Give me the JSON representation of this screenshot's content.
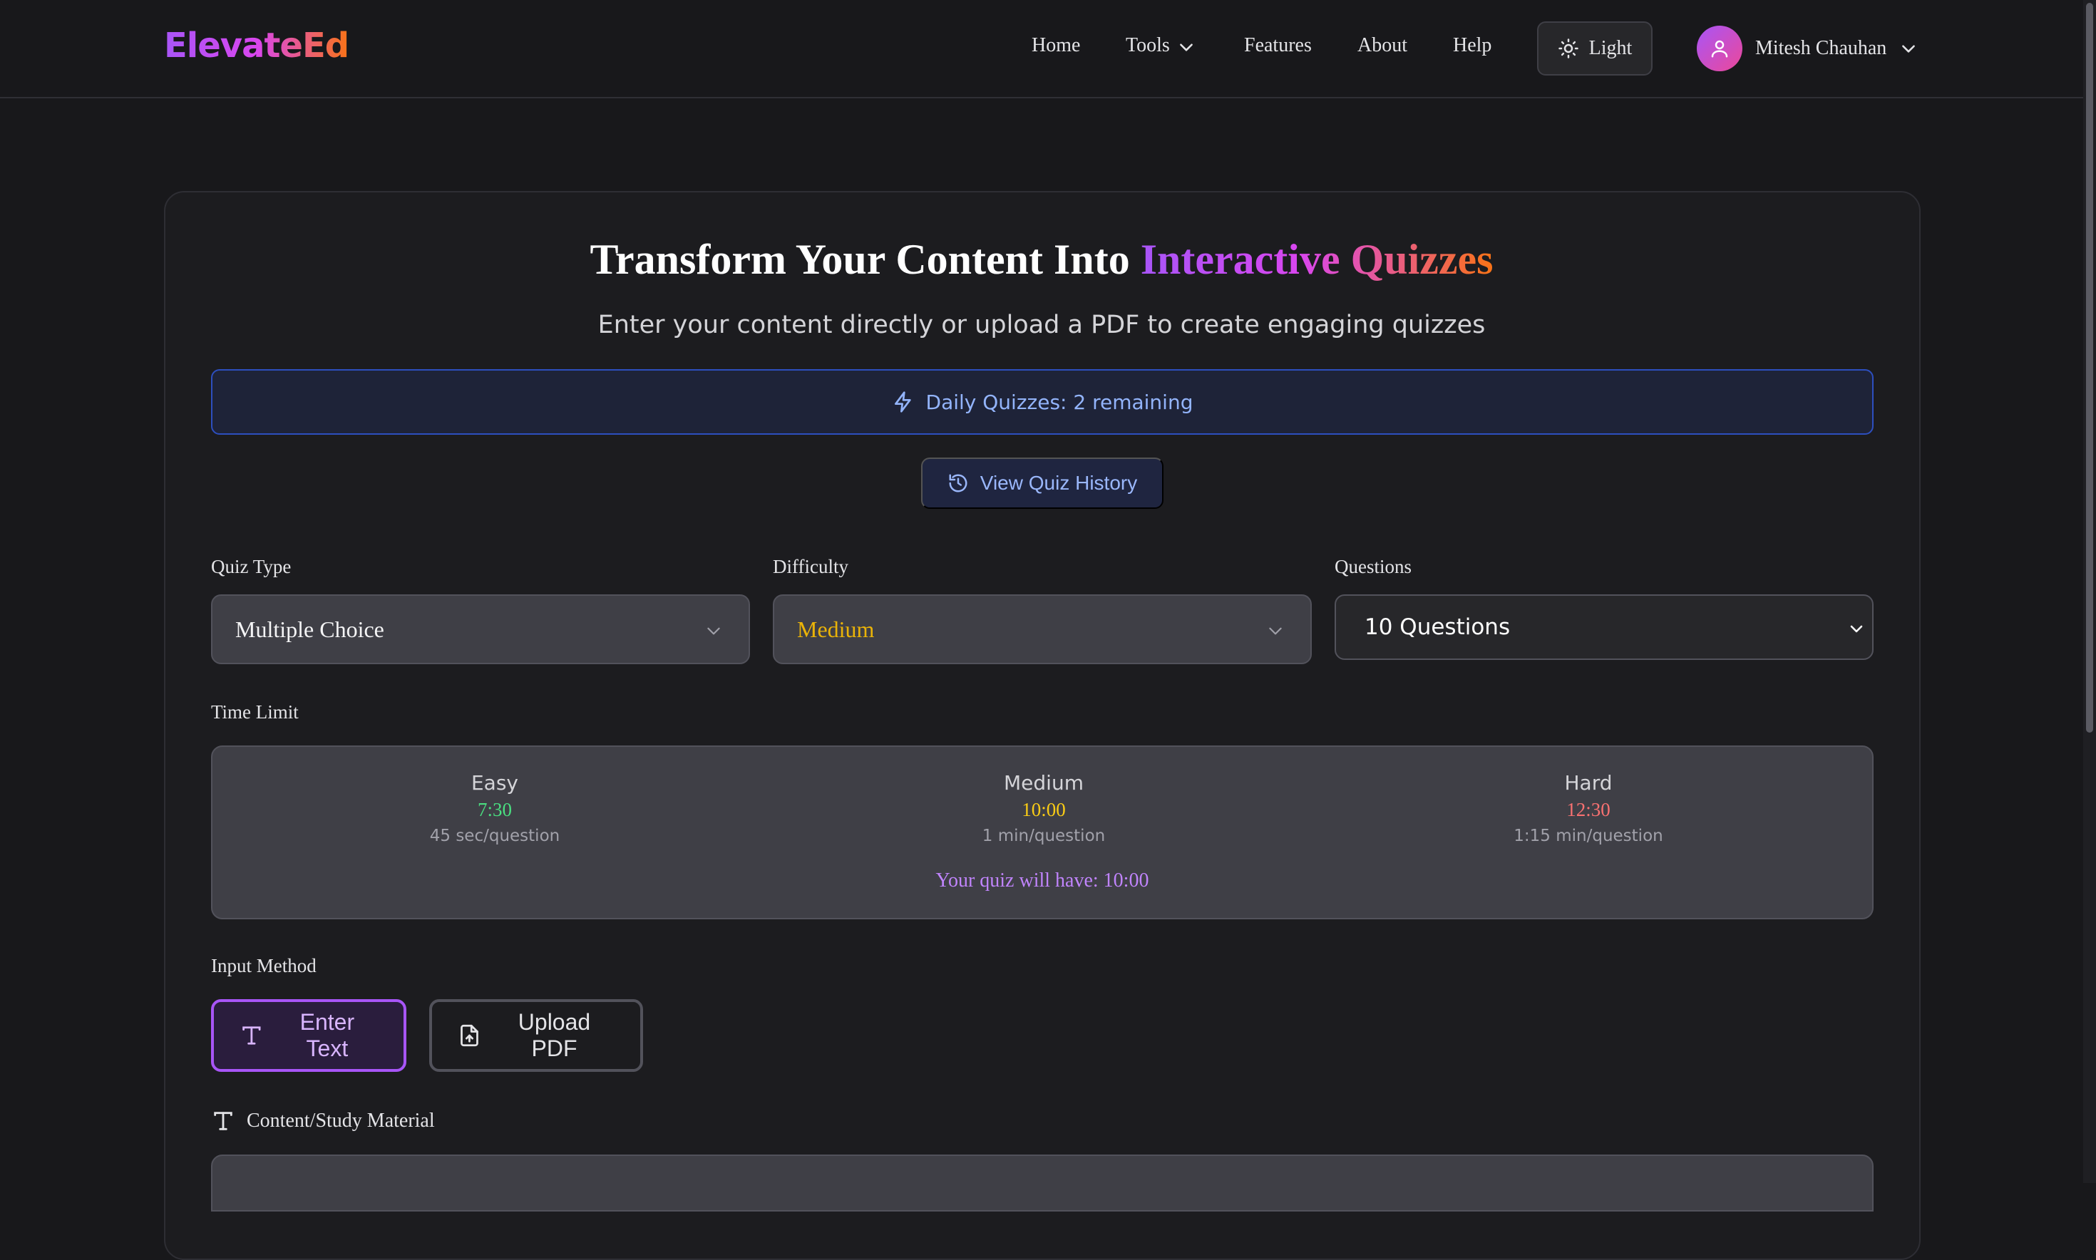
{
  "brand": {
    "logo": "ElevateEd"
  },
  "nav": {
    "links": [
      "Home",
      "Tools",
      "Features",
      "About",
      "Help"
    ],
    "theme_label": "Light",
    "user_name": "Mitesh Chauhan"
  },
  "hero": {
    "title_plain": "Transform Your Content Into ",
    "title_highlight": "Interactive Quizzes",
    "subtitle": "Enter your content directly or upload a PDF to create engaging quizzes"
  },
  "daily": {
    "text": "Daily Quizzes: 2 remaining"
  },
  "history": {
    "label": "View Quiz History"
  },
  "settings": {
    "quiz_type": {
      "label": "Quiz Type",
      "value": "Multiple Choice"
    },
    "difficulty": {
      "label": "Difficulty",
      "value": "Medium",
      "color": "#eab308"
    },
    "questions": {
      "label": "Questions",
      "value": "10 Questions"
    }
  },
  "time_limit": {
    "label": "Time Limit",
    "levels": [
      {
        "name": "Easy",
        "time": "7:30",
        "rate": "45 sec/question",
        "color": "#4ade80"
      },
      {
        "name": "Medium",
        "time": "10:00",
        "rate": "1 min/question",
        "color": "#facc15"
      },
      {
        "name": "Hard",
        "time": "12:30",
        "rate": "1:15 min/question",
        "color": "#f87171"
      }
    ],
    "summary": "Your quiz will have: 10:00"
  },
  "input_method": {
    "label": "Input Method",
    "options": [
      "Enter Text",
      "Upload PDF"
    ],
    "active": "Enter Text"
  },
  "content": {
    "label": "Content/Study Material"
  },
  "icons": {
    "tools_chevron": "chevron-down-icon",
    "theme": "sun-icon",
    "user": "user-icon",
    "daily": "lightning-icon",
    "history": "history-icon",
    "text": "text-icon",
    "pdf": "file-upload-icon"
  }
}
